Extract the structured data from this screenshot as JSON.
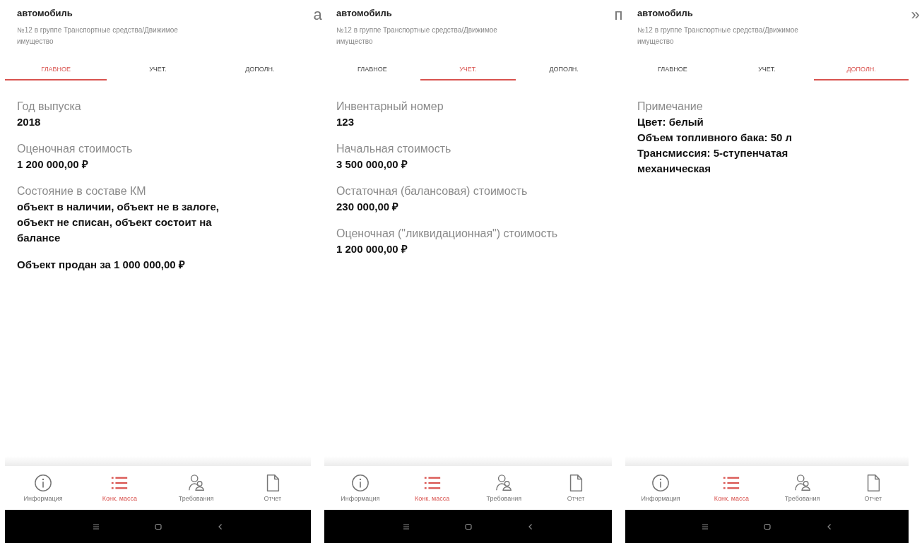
{
  "screens": [
    {
      "title": "автомобиль",
      "subtitle": "№12 в группе Транспортные средства/Движимое имущество",
      "tabs": [
        {
          "label": "ГЛАВНОЕ",
          "selected": true
        },
        {
          "label": "УЧЕТ.",
          "selected": false
        },
        {
          "label": "ДОПОЛН.",
          "selected": false
        }
      ],
      "fields": [
        {
          "label": "Год выпуска",
          "value": "2018"
        },
        {
          "label": "Оценочная стоимость",
          "value": "1 200 000,00 ₽"
        },
        {
          "label": "Состояние в составе КМ",
          "value": "объект в наличии, объект не в залоге, объект не списан, объект состоит на балансе"
        },
        {
          "value": "Объект продан за 1 000 000,00 ₽"
        }
      ],
      "nav": [
        {
          "label": "Информация",
          "selected": false
        },
        {
          "label": "Конк. масса",
          "selected": true
        },
        {
          "label": "Требования",
          "selected": false
        },
        {
          "label": "Отчет",
          "selected": false
        }
      ],
      "fragment": "а"
    },
    {
      "title": "автомобиль",
      "subtitle": "№12 в группе Транспортные средства/Движимое имущество",
      "tabs": [
        {
          "label": "ГЛАВНОЕ",
          "selected": false
        },
        {
          "label": "УЧЕТ.",
          "selected": true
        },
        {
          "label": "ДОПОЛН.",
          "selected": false
        }
      ],
      "fields": [
        {
          "label": "Инвентарный номер",
          "value": "123"
        },
        {
          "label": "Начальная стоимость",
          "value": "3 500 000,00 ₽"
        },
        {
          "label": "Остаточная (балансовая) стоимость",
          "value": "230 000,00 ₽"
        },
        {
          "label": "Оценочная (\"ликвидационная\") стоимость",
          "value": "1 200 000,00 ₽"
        }
      ],
      "nav": [
        {
          "label": "Информация",
          "selected": false
        },
        {
          "label": "Конк. масса",
          "selected": true
        },
        {
          "label": "Требования",
          "selected": false
        },
        {
          "label": "Отчет",
          "selected": false
        }
      ],
      "fragment": "п"
    },
    {
      "title": "автомобиль",
      "subtitle": "№12 в группе Транспортные средства/Движимое имущество",
      "tabs": [
        {
          "label": "ГЛАВНОЕ",
          "selected": false
        },
        {
          "label": "УЧЕТ.",
          "selected": false
        },
        {
          "label": "ДОПОЛН.",
          "selected": true
        }
      ],
      "fields": [
        {
          "label": "Примечание",
          "lines": [
            "Цвет: белый",
            "Объем топливного бака: 50 л",
            "Трансмиссия:  5-ступенчатая механическая"
          ]
        }
      ],
      "nav": [
        {
          "label": "Информация",
          "selected": false
        },
        {
          "label": "Конк. масса",
          "selected": true
        },
        {
          "label": "Требования",
          "selected": false
        },
        {
          "label": "Отчет",
          "selected": false
        }
      ],
      "fragment": "»"
    }
  ]
}
